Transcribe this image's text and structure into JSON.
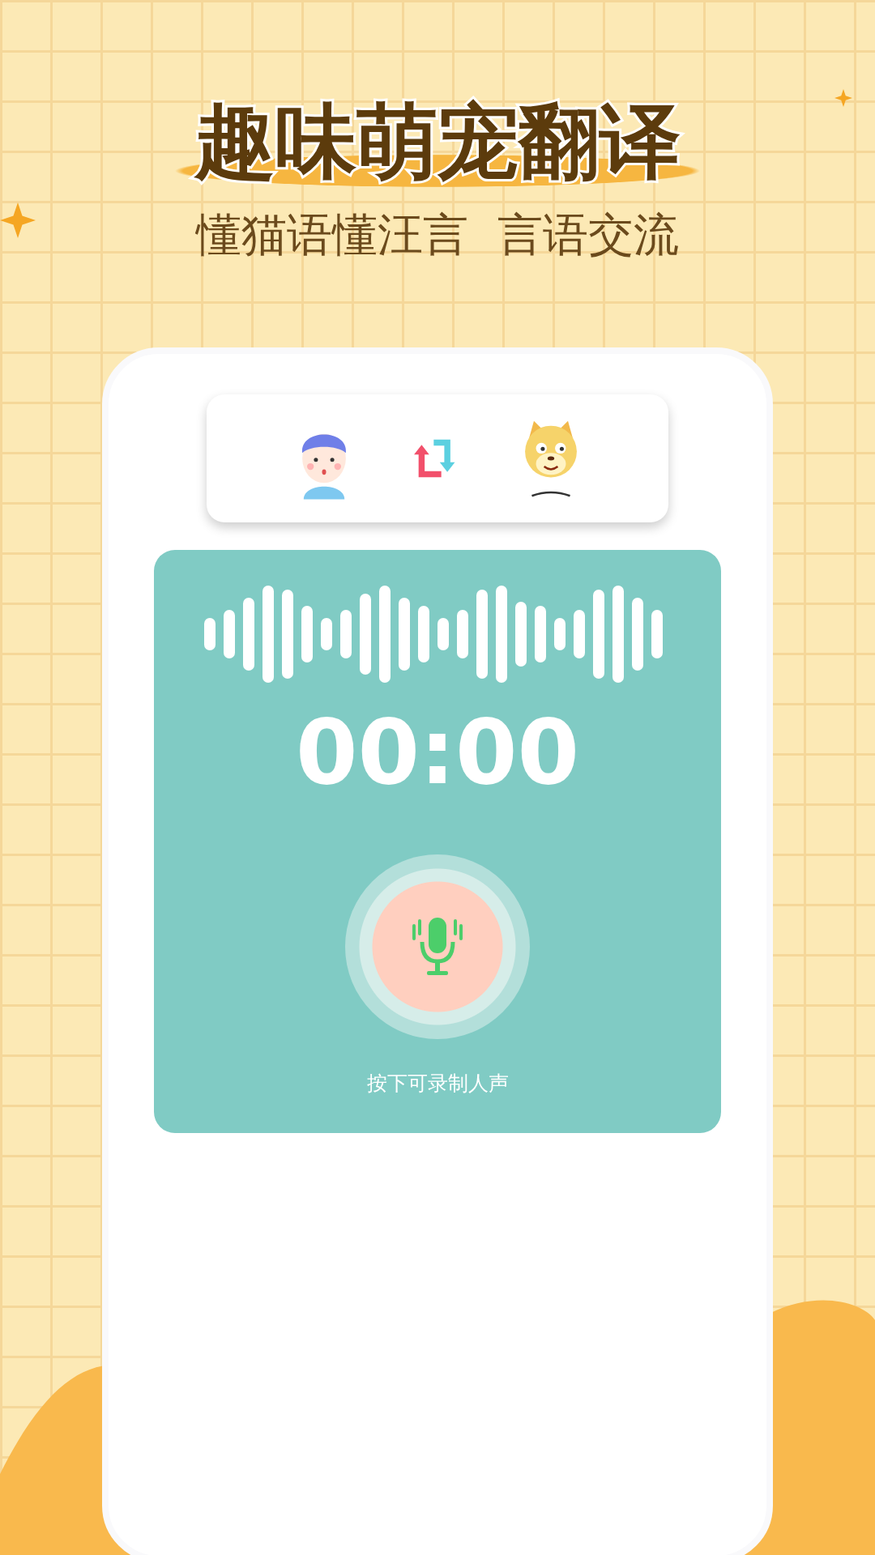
{
  "header": {
    "title": "趣味萌宠翻译",
    "subtitle": "懂猫语懂汪言  言语交流"
  },
  "recorder": {
    "timer": "00:00",
    "hint": "按下可录制人声"
  }
}
